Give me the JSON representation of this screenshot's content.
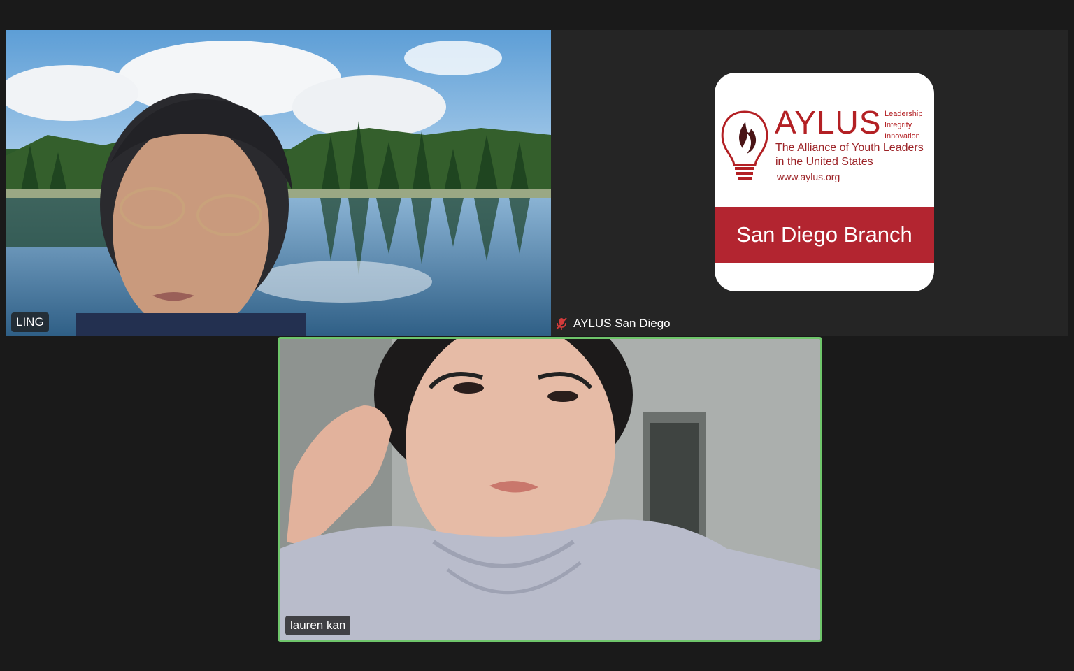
{
  "participants": [
    {
      "name": "LING"
    },
    {
      "name": "AYLUS San Diego",
      "muted": true
    },
    {
      "name": "lauren kan",
      "active_speaker": true
    }
  ],
  "aylus_logo": {
    "wordmark": "AYLUS",
    "motto": [
      "Leadership",
      "Integrity",
      "Innovation"
    ],
    "line1": "The Alliance of Youth Leaders",
    "line2": "in the United States",
    "url": "www.aylus.org",
    "branch": "San Diego Branch"
  },
  "colors": {
    "background": "#1a1a1a",
    "active_border": "#6fc56b",
    "brand_red": "#b32530"
  }
}
